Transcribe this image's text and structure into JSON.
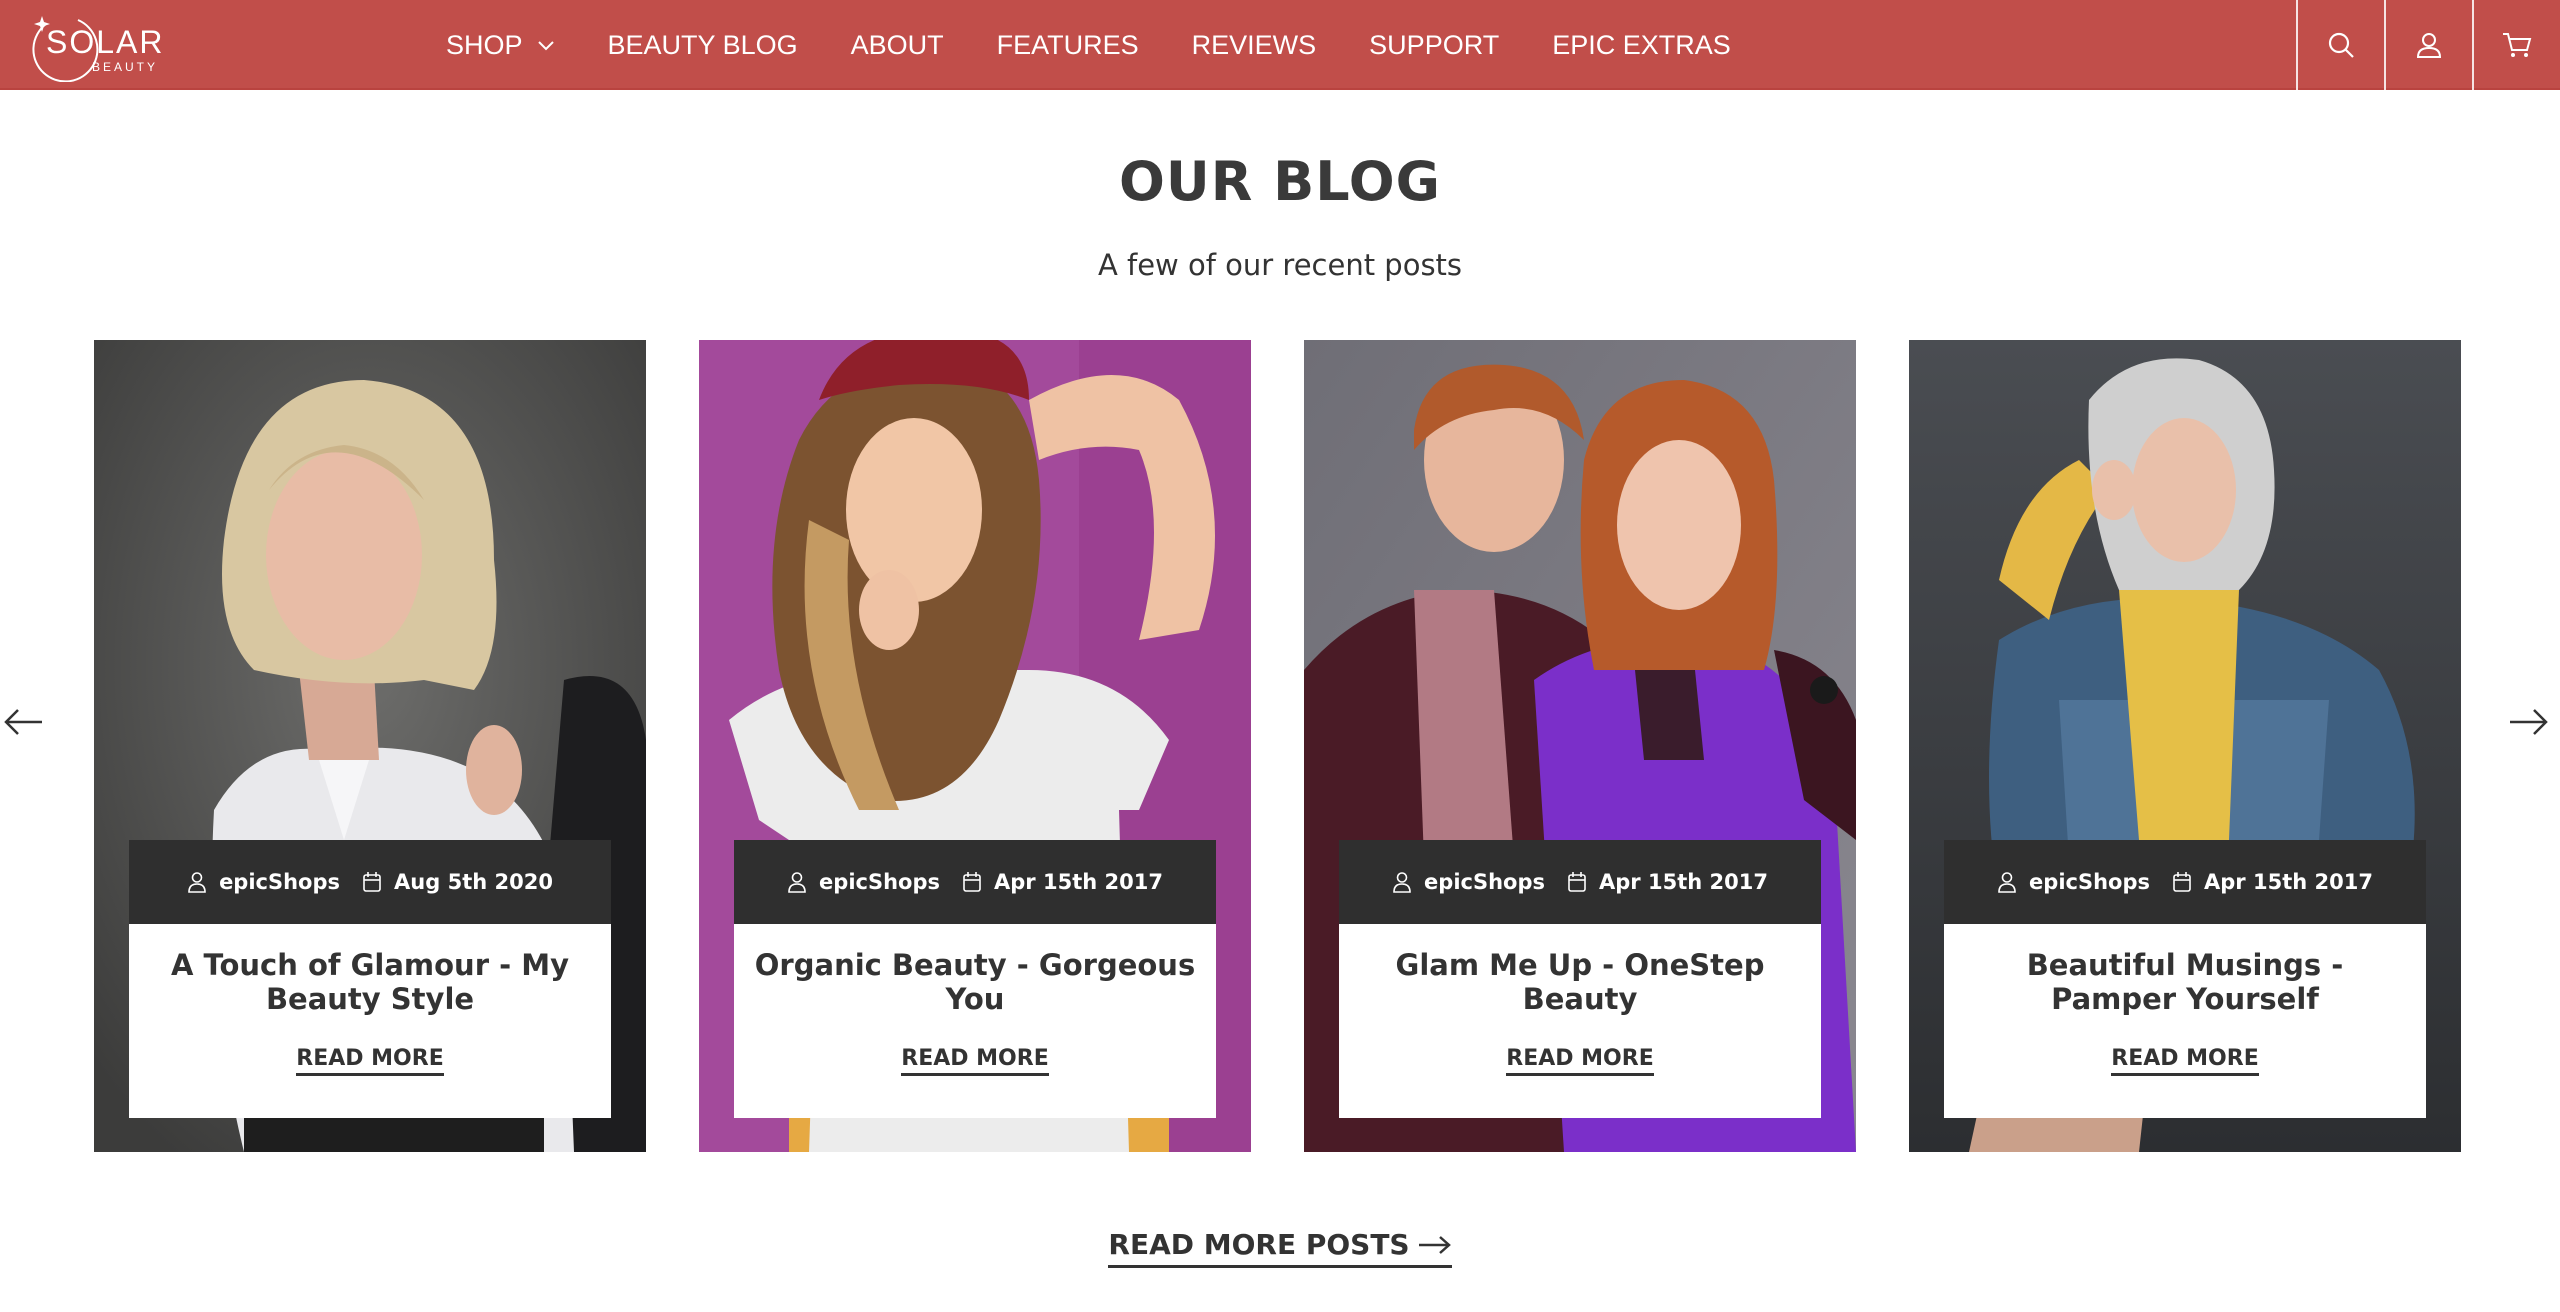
{
  "header": {
    "logo_text": "SOLAR",
    "logo_subtext": "BEAUTY",
    "nav": [
      {
        "label": "SHOP"
      },
      {
        "label": "BEAUTY BLOG"
      },
      {
        "label": "ABOUT"
      },
      {
        "label": "FEATURES"
      },
      {
        "label": "REVIEWS"
      },
      {
        "label": "SUPPORT"
      },
      {
        "label": "EPIC EXTRAS"
      }
    ],
    "icons": [
      "search-icon",
      "account-icon",
      "cart-icon"
    ],
    "background_color": "#c14e4a"
  },
  "section": {
    "title": "OUR BLOG",
    "subtitle": "A few of our recent posts"
  },
  "posts": [
    {
      "author": "epicShops",
      "date": "Aug 5th 2020",
      "title": "A Touch of Glamour - My Beauty Style",
      "cta": "READ MORE"
    },
    {
      "author": "epicShops",
      "date": "Apr 15th 2017",
      "title": "Organic Beauty - Gorgeous You",
      "cta": "READ MORE"
    },
    {
      "author": "epicShops",
      "date": "Apr 15th 2017",
      "title": "Glam Me Up - OneStep Beauty",
      "cta": "READ MORE"
    },
    {
      "author": "epicShops",
      "date": "Apr 15th 2017",
      "title": "Beautiful Musings - Pamper Yourself",
      "cta": "READ MORE"
    }
  ],
  "footer_link": {
    "label": "READ MORE POSTS"
  },
  "colors": {
    "brand": "#c14e4a",
    "meta_bar": "#2f2f2f",
    "text": "#333333"
  }
}
